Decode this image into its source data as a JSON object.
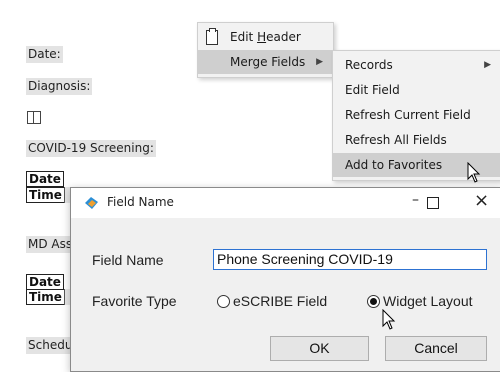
{
  "document": {
    "labels": {
      "date": "Date:",
      "diagnosis": "Diagnosis:",
      "covid_screening": "COVID-19 Screening:",
      "md_assessment": "MD Asse",
      "schedule": "Schedul"
    },
    "fields": {
      "date1": "Date",
      "time1": "Time",
      "date2": "Date",
      "time2": "Time"
    }
  },
  "context_menu": {
    "items": [
      {
        "label": "Edit Header",
        "mnemonic": "H",
        "icon": "page-icon"
      },
      {
        "label": "Merge Fields",
        "has_submenu": true,
        "highlighted": true
      }
    ]
  },
  "submenu": {
    "items": [
      {
        "label": "Records",
        "has_submenu": true
      },
      {
        "label": "Edit Field"
      },
      {
        "label": "Refresh Current Field"
      },
      {
        "label": "Refresh All Fields"
      },
      {
        "label": "Add to Favorites",
        "highlighted": true
      }
    ]
  },
  "dialog": {
    "title": "Field Name",
    "field_name_label": "Field Name",
    "field_name_value": "Phone Screening COVID-19",
    "favorite_type_label": "Favorite Type",
    "radio_options": [
      {
        "label": "eSCRIBE Field",
        "selected": false
      },
      {
        "label": "Widget Layout",
        "selected": true
      }
    ],
    "ok_label": "OK",
    "cancel_label": "Cancel",
    "minimize_glyph": "–",
    "close_glyph": "×"
  },
  "colors": {
    "menu_bg": "#f2f2f2",
    "highlight": "#cfcfcf",
    "input_border": "#2d72d2",
    "dialog_bg": "#f0f0f0"
  }
}
